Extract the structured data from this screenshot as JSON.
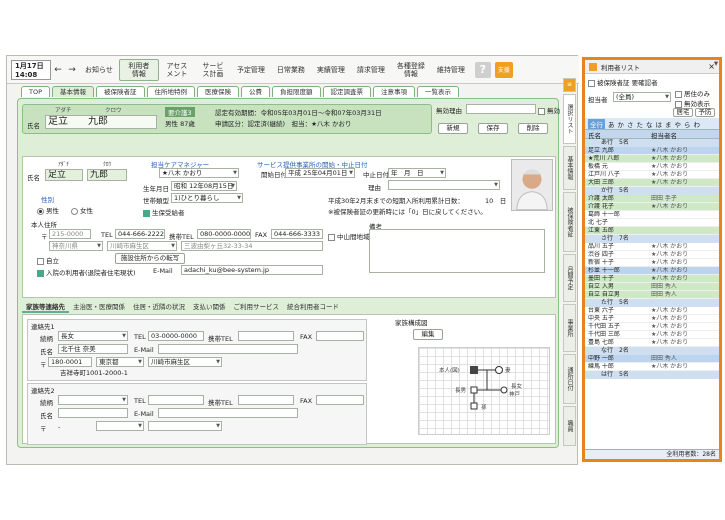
{
  "topbar": {
    "date": "1月17日",
    "time": "14:08",
    "nav": [
      "お知らせ",
      "利用者情報",
      "アセスメント",
      "サービス計画",
      "予定管理",
      "日常業務",
      "実績管理",
      "請求管理",
      "各種登録情報",
      "維持管理"
    ],
    "help": "?",
    "support": "支援"
  },
  "tabs": [
    "TOP",
    "基本情報",
    "被保険者証",
    "住所地特例",
    "医療保険",
    "公費",
    "負担限度額",
    "認定調査票",
    "注意事項",
    "一覧表示"
  ],
  "header": {
    "kana_sei": "アダチ",
    "kana_mei": "クロウ",
    "name_label": "氏名",
    "sei": "足立",
    "mei": "九郎",
    "badge": "要介護3",
    "sex_age": "男性 87歳",
    "period": "認定有効期間：令和05年03月01日～令和07年03月31日",
    "status": "申請区分：認定済(継続)　担当：★八木 かおり",
    "muko_label": "無効理由",
    "muko_chk": "無効",
    "new": "新規",
    "save": "保存",
    "delete": "削除"
  },
  "basic": {
    "kana_label": "ｱﾀﾞﾁ",
    "kana2": "ｸﾛｳ",
    "name_label": "氏名",
    "sei": "足立",
    "mei": "九郎",
    "cm_label": "担当ケアマネジャー",
    "cm": "★八木 かおり",
    "svc_label": "サービス提供事業所の開始・中止日付",
    "start_label": "開始日付",
    "start": "平成 25年04月01日",
    "stop_label": "中止日付",
    "stop": "年　月　日",
    "reason": "理由",
    "dob_label": "生年月日",
    "dob": "昭和 12年08月15日",
    "sex_label": "性別",
    "male": "男性",
    "female": "女性",
    "setai_label": "世帯類型",
    "setai": "1)ひとり暮らし",
    "seiho": "生保受給者",
    "notice1": "平成30年2月末までの短期入所利用累計日数：",
    "days": "10　日",
    "notice2": "※被保険者証の更新時には「0」日に戻してください。",
    "addr_label": "本人住所",
    "zip": "215-0000",
    "tel_label": "TEL",
    "tel": "044-666-2222",
    "mobile_label": "携帯TEL",
    "mobile": "080-0000-0000",
    "fax_label": "FAX",
    "fax": "044-666-3333",
    "mountain": "中山間地域に居住",
    "pref": "神奈川県",
    "city": "川崎市麻生区",
    "street": "三波由梨ヶ丘32-33-34",
    "jiritsu": "自立",
    "nyusho": "入院の利用者(退院者住宅現状)",
    "facility_btn": "施設住所からの転写",
    "email_label": "E-Mail",
    "email": "adachi_ku@bee-system.jp",
    "biko": "備考"
  },
  "subtabs": [
    "家族等連絡先",
    "主治医・医療関係",
    "住居・近隣の状況",
    "支払い関係",
    "ご利用サービス",
    "統合利用者コード"
  ],
  "contact1": {
    "title": "連絡先1",
    "rel_label": "続柄",
    "rel": "長女",
    "tel_label": "TEL",
    "tel": "03-0000-0000",
    "mtel": "携帯TEL",
    "fax": "FAX",
    "name_label": "氏名",
    "name": "北千住 奈美",
    "email": "E-Mail",
    "zip": "180-0001",
    "pref": "東京都",
    "city": "川崎市麻生区",
    "addr": "吉祥寺町1001-2000-1"
  },
  "contact2": {
    "title": "連絡先2",
    "rel_label": "続柄",
    "tel_label": "TEL",
    "mtel": "携帯TEL",
    "fax": "FAX",
    "name_label": "氏名",
    "email": "E-Mail",
    "zip": "〒",
    "dash": "-"
  },
  "family": {
    "title": "家族構成図",
    "edit": "編集",
    "self": "本人(図)",
    "wife": "妻",
    "son": "長男",
    "daughter": "長女",
    "daughter2": "神戸",
    "grand": "孫"
  },
  "sidetabs": [
    "選択リスト",
    "基本情報",
    "被保険者証",
    "月間予定",
    "事業所",
    "通所日付",
    "職員"
  ],
  "list": {
    "title": "利用者リスト",
    "close": "×",
    "chk1": "被保険者証 要確認者",
    "tanto_label": "担当者",
    "tanto": "(全員)",
    "chk2": "居住のみ",
    "chk3": "無効表示",
    "btn1": "居宅",
    "btn2": "予防",
    "kana": [
      "全行",
      "あ",
      "か",
      "さ",
      "た",
      "な",
      "は",
      "ま",
      "や",
      "ら",
      "わ"
    ],
    "col_name": "氏名",
    "col_cm": "担当者名",
    "groups": [
      {
        "label": "あ行　5名",
        "rows": [
          [
            "足立 九郎",
            "★八木 かおり",
            "sel"
          ],
          [
            "★荒川 八郎",
            "★八木 かおり",
            "green"
          ],
          [
            "板橋 元",
            "★八木 かおり",
            ""
          ],
          [
            "江戸川 八子",
            "★八木 かおり",
            ""
          ],
          [
            "大田 三郎",
            "★八木 かおり",
            "green"
          ]
        ]
      },
      {
        "label": "か行　5名",
        "rows": [
          [
            "介護 太郎",
            "田田 手子",
            "green"
          ],
          [
            "介護 花子",
            "★八木 かおり",
            "green"
          ],
          [
            "葛飾 十一郎",
            "",
            ""
          ],
          [
            "北 七子",
            "",
            ""
          ],
          [
            "江東 五郎",
            "",
            "green"
          ]
        ]
      },
      {
        "label": "さ行　7名",
        "rows": [
          [
            "品川 五子",
            "★八木 かおり",
            ""
          ],
          [
            "渋谷 四子",
            "★八木 かおり",
            ""
          ],
          [
            "新宿 十子",
            "★八木 かおり",
            ""
          ],
          [
            "杉並 十一郎",
            "★八木 かおり",
            "sel"
          ],
          [
            "墨田 十子",
            "★八木 かおり",
            "green"
          ],
          [
            "自立 入男",
            "田田 秀人",
            "green"
          ],
          [
            "自立 自立男",
            "田田 秀人",
            "green"
          ]
        ]
      },
      {
        "label": "た行　5名",
        "rows": [
          [
            "台東 六子",
            "★八木 かおり",
            ""
          ],
          [
            "中央 五子",
            "★八木 かおり",
            ""
          ],
          [
            "千代田 五子",
            "★八木 かおり",
            ""
          ],
          [
            "千代田 三郎",
            "★八木 かおり",
            ""
          ],
          [
            "豊島 七郎",
            "★八木 かおり",
            ""
          ]
        ]
      },
      {
        "label": "な行　2名",
        "rows": [
          [
            "中野 一郎",
            "田田 秀人",
            "sel"
          ],
          [
            "練馬 十郎",
            "★八木 かおり",
            ""
          ]
        ]
      },
      {
        "label": "は行　5名",
        "rows": []
      }
    ],
    "total": "全利用者数：28名"
  }
}
